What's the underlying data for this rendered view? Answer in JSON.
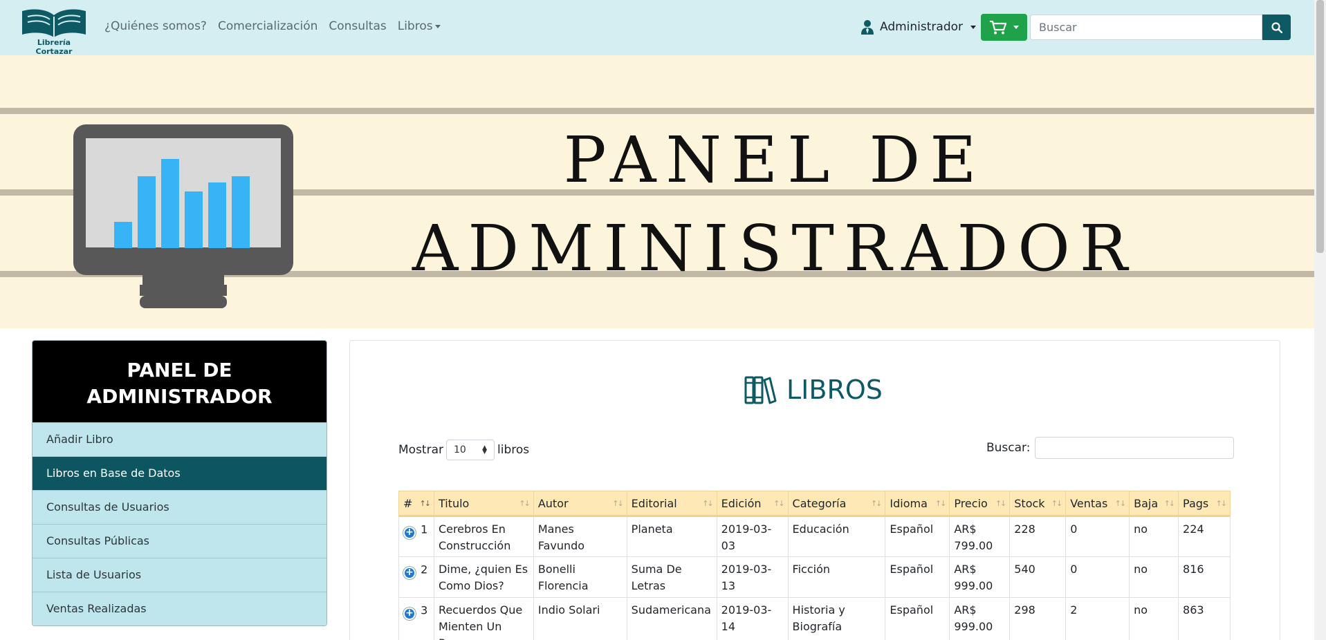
{
  "navbar": {
    "logo_text": "Librería Cortazar",
    "links": [
      "¿Quiénes somos?",
      "Comercialización",
      "Consultas",
      "Libros"
    ],
    "user_label": "Administrador",
    "search_placeholder": "Buscar"
  },
  "hero": {
    "title_line1": "PANEL DE",
    "title_line2": "ADMINISTRADOR"
  },
  "sidebar": {
    "title_line1": "PANEL DE",
    "title_line2": "ADMINISTRADOR",
    "items": [
      {
        "label": "Añadir Libro",
        "active": false
      },
      {
        "label": "Libros en Base de Datos",
        "active": true
      },
      {
        "label": "Consultas de Usuarios",
        "active": false
      },
      {
        "label": "Consultas Públicas",
        "active": false
      },
      {
        "label": "Lista de Usuarios",
        "active": false
      },
      {
        "label": "Ventas Realizadas",
        "active": false
      }
    ]
  },
  "main": {
    "title": "LIBROS",
    "show_label": "Mostrar",
    "show_value": "10",
    "show_suffix": "libros",
    "search_label": "Buscar:",
    "columns": [
      "#",
      "Titulo",
      "Autor",
      "Editorial",
      "Edición",
      "Categoría",
      "Idioma",
      "Precio",
      "Stock",
      "Ventas",
      "Baja",
      "Pags"
    ],
    "rows": [
      [
        "1",
        "Cerebros En Construcción",
        "Manes Favundo",
        "Planeta",
        "2019-03-03",
        "Educación",
        "Español",
        "AR$ 799.00",
        "228",
        "0",
        "no",
        "224"
      ],
      [
        "2",
        "Dime, ¿quien Es Como Dios?",
        "Bonelli Florencia",
        "Suma De Letras",
        "2019-03-13",
        "Ficción",
        "Español",
        "AR$ 999.00",
        "540",
        "0",
        "no",
        "816"
      ],
      [
        "3",
        "Recuerdos Que Mienten Un Poco",
        "Indio Solari",
        "Sudamericana",
        "2019-03-14",
        "Historia y Biografía",
        "Español",
        "AR$ 999.00",
        "298",
        "2",
        "no",
        "863"
      ]
    ]
  },
  "colors": {
    "navbar_bg": "#d4eef2",
    "hero_bg": "#fdf4dc",
    "accent_teal": "#0e5a64",
    "cart_green": "#1fa24a",
    "table_header": "#fde8b6",
    "chart_bars": "#36b4f5"
  }
}
